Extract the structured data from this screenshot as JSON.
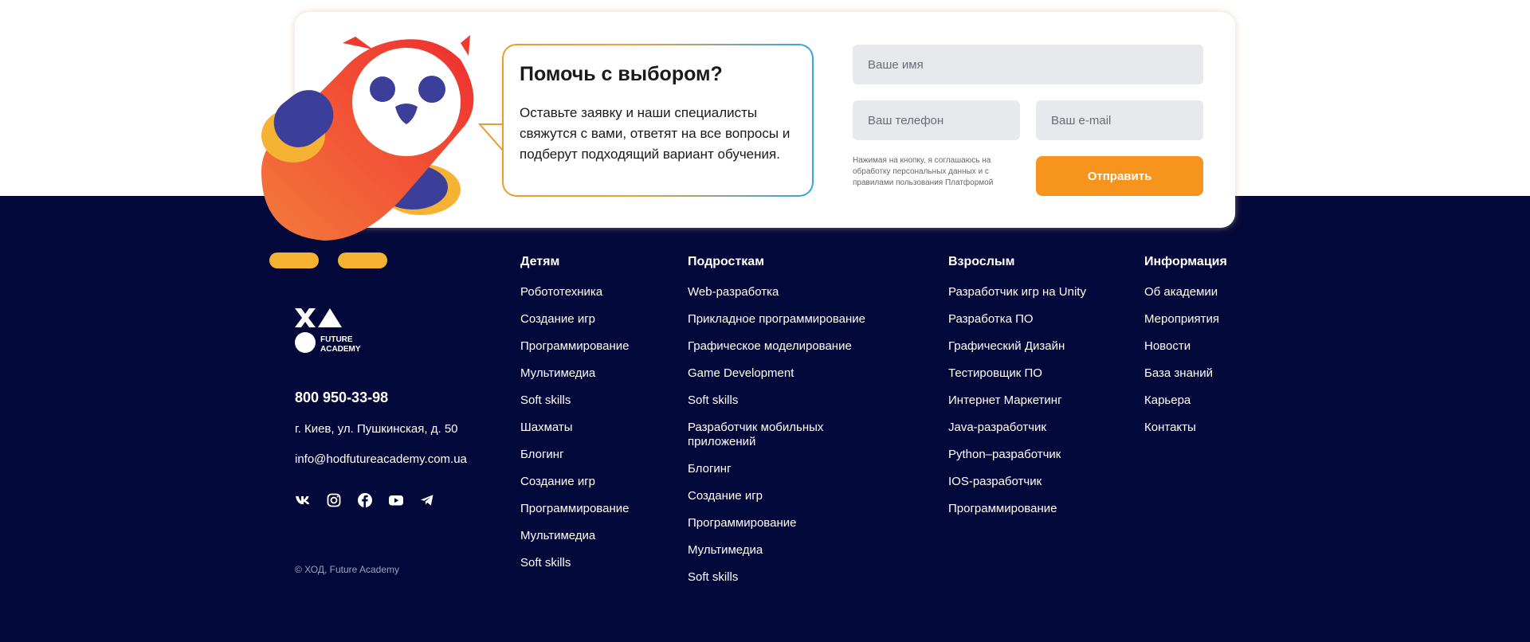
{
  "lead_form": {
    "title": "Помочь с выбором?",
    "text": "Оставьте заявку и наши специалисты свяжутся с вами, ответят на все вопросы и подберут подходящий вариант обучения.",
    "name_placeholder": "Ваше имя",
    "phone_placeholder": "Ваш телефон",
    "email_placeholder": "Ваш e-mail",
    "consent": "Нажимая на кнопку, я соглашаюсь на обработку персональных данных и с правилами пользования Платформой",
    "submit_label": "Отправить"
  },
  "brand": {
    "logo_text_line1": "FUTURE",
    "logo_text_line2": "ACADEMY",
    "phone": "800 950-33-98",
    "address": "г. Киев, ул. Пушкинская, д. 50",
    "email": "info@hodfutureacademy.com.ua",
    "copyright": "© ХОД, Future Academy"
  },
  "socials": [
    "vk-icon",
    "instagram-icon",
    "facebook-icon",
    "youtube-icon",
    "telegram-icon"
  ],
  "columns": {
    "kids": {
      "title": "Детям",
      "items": [
        "Робототехника",
        "Создание игр",
        "Программирование",
        "Мультимедиа",
        "Soft skills",
        "Шахматы",
        "Блогинг",
        "Создание игр",
        "Программирование",
        "Мультимедиа",
        "Soft skills"
      ]
    },
    "teens": {
      "title": "Подросткам",
      "items": [
        "Web-разработка",
        "Прикладное программирование",
        "Графическое моделирование",
        "Game Development",
        "Soft skills",
        "Разработчик мобильных приложений",
        "Блогинг",
        "Создание игр",
        "Программирование",
        "Мультимедиа",
        "Soft skills"
      ]
    },
    "adults": {
      "title": "Взрослым",
      "items": [
        "Разработчик игр на Unity",
        "Разработка ПО",
        "Графический Дизайн",
        "Тестировщик ПО",
        "Интернет Маркетинг",
        "Java-разработчик",
        "Python–разработчик",
        "IOS-разработчик",
        "Программирование"
      ]
    },
    "info": {
      "title": "Информация",
      "items": [
        "Об академии",
        "Мероприятия",
        "Новости",
        "База знаний",
        "Карьера",
        "Контакты"
      ]
    }
  },
  "colors": {
    "footer_bg": "#03083a",
    "accent_orange": "#f7941e",
    "input_bg": "#e8e9ed"
  }
}
